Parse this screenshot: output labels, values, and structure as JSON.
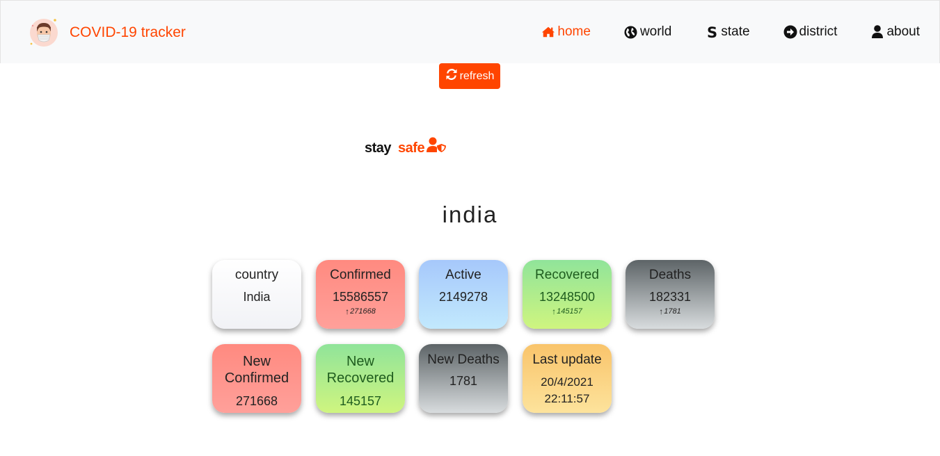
{
  "brand": {
    "title": "COVID-19 tracker",
    "logo": "masked-person-icon"
  },
  "nav": {
    "items": [
      {
        "label": "home",
        "icon": "home-icon",
        "active": true
      },
      {
        "label": "world",
        "icon": "globe-icon",
        "active": false
      },
      {
        "label": "state",
        "icon": "s-icon",
        "active": false
      },
      {
        "label": "district",
        "icon": "arrow-circle-icon",
        "active": false
      },
      {
        "label": "about",
        "icon": "user-icon",
        "active": false
      }
    ]
  },
  "refresh": {
    "label": "refresh",
    "icon": "sync-icon"
  },
  "slogan": {
    "stay": "stay",
    "safe": "safe",
    "icon": "user-shield-icon"
  },
  "country_name": "india",
  "cards": {
    "country": {
      "label": "country",
      "value": "India"
    },
    "confirmed": {
      "label": "Confirmed",
      "value": "15586557",
      "delta": "271668"
    },
    "active": {
      "label": "Active",
      "value": "2149278"
    },
    "recovered": {
      "label": "Recovered",
      "value": "13248500",
      "delta": "145157"
    },
    "deaths": {
      "label": "Deaths",
      "value": "182331",
      "delta": "1781"
    },
    "new_confirmed": {
      "label": "New Confirmed",
      "value": "271668"
    },
    "new_recovered": {
      "label": "New Recovered",
      "value": "145157"
    },
    "new_deaths": {
      "label": "New Deaths",
      "value": "1781"
    },
    "last_update": {
      "label": "Last update",
      "date": "20/4/2021",
      "time": "22:11:57"
    }
  },
  "colors": {
    "accent": "#ff4500",
    "navbar_bg": "#f8f9fa"
  }
}
